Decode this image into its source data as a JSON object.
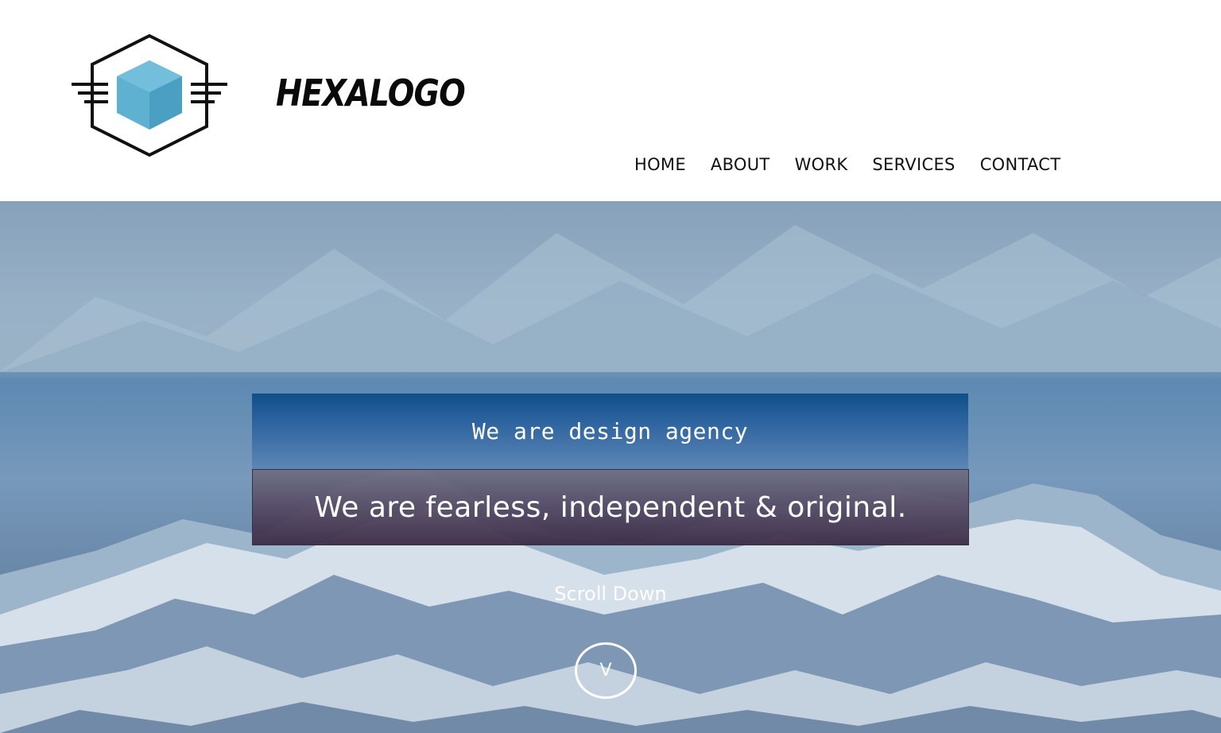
{
  "header": {
    "brand_name": "HEXALOGO",
    "logo_icon": "hexagon-cube-logo-icon",
    "nav": [
      {
        "label": "HOME"
      },
      {
        "label": "ABOUT"
      },
      {
        "label": "WORK"
      },
      {
        "label": "SERVICES"
      },
      {
        "label": "CONTACT"
      }
    ]
  },
  "hero": {
    "tagline": "We are design agency",
    "headline": "We are fearless, independent & original.",
    "scroll_label": "Scroll Down",
    "scroll_icon_glyph": "V",
    "scroll_icon": "chevron-down-icon"
  },
  "colors": {
    "logo_accent": "#4aa3c8",
    "agency_box": "#1f5a96",
    "fearless_box": "#4e3f5c",
    "text_light": "#ffffff",
    "text_dark": "#111111"
  }
}
